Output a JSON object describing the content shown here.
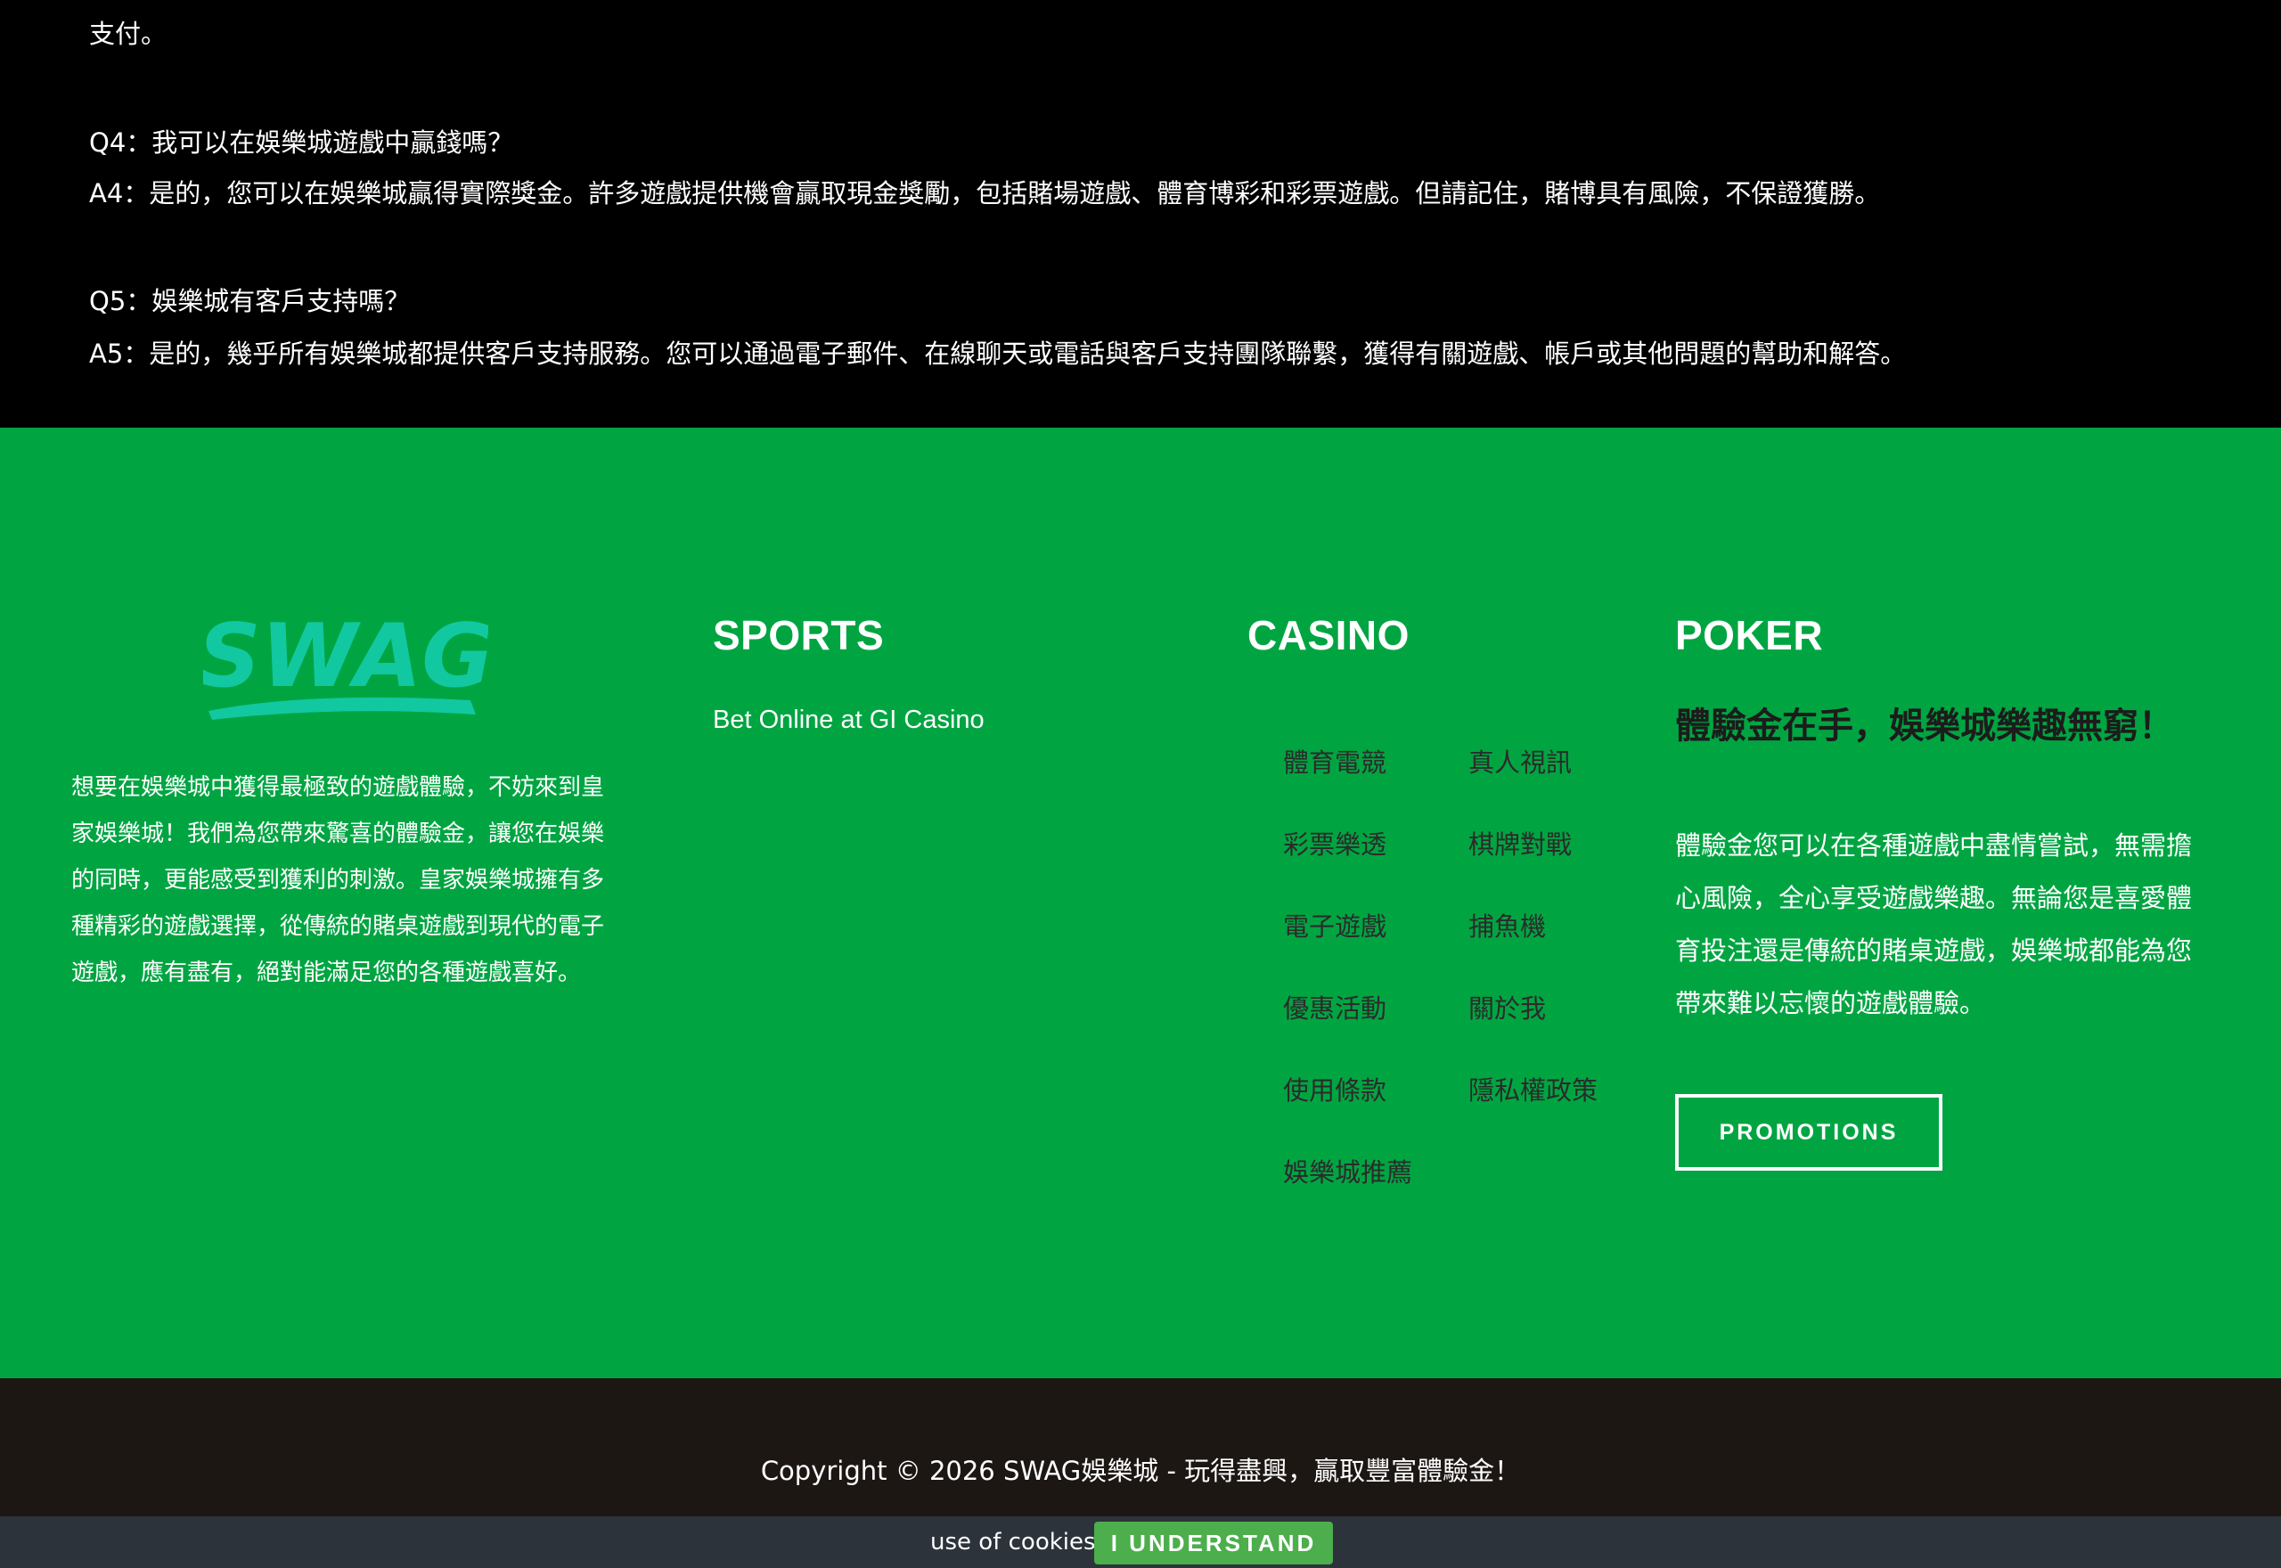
{
  "faq": {
    "lines": [
      "支付。",
      "Q4：我可以在娛樂城遊戲中贏錢嗎？",
      "A4：是的，您可以在娛樂城贏得實際獎金。許多遊戲提供機會贏取現金獎勵，包括賭場遊戲、體育博彩和彩票遊戲。但請記住，賭博具有風險，不保證獲勝。",
      "Q5：娛樂城有客戶支持嗎？",
      "A5：是的，幾乎所有娛樂城都提供客戶支持服務。您可以通過電子郵件、在線聊天或電話與客戶支持團隊聯繫，獲得有關遊戲、帳戶或其他問題的幫助和解答。"
    ]
  },
  "footer": {
    "logo_text": "SWAG",
    "about": "想要在娛樂城中獲得最極致的遊戲體驗，不妨來到皇家娛樂城！我們為您帶來驚喜的體驗金，讓您在娛樂的同時，更能感受到獲利的刺激。皇家娛樂城擁有多種精彩的遊戲選擇，從傳統的賭桌遊戲到現代的電子遊戲，應有盡有，絕對能滿足您的各種遊戲喜好。",
    "sports": {
      "title": "SPORTS",
      "link": "Bet Online at GI Casino"
    },
    "casino": {
      "title": "CASINO",
      "links": [
        "體育電競",
        "真人視訊",
        "彩票樂透",
        "棋牌對戰",
        "電子遊戲",
        "捕魚機",
        "優惠活動",
        "關於我",
        "使用條款",
        "隱私權政策",
        "娛樂城推薦"
      ]
    },
    "poker": {
      "title": "POKER",
      "heading": "體驗金在手，娛樂城樂趣無窮！",
      "text": "體驗金您可以在各種遊戲中盡情嘗試，無需擔心風險，全心享受遊戲樂趣。無論您是喜愛體育投注還是傳統的賭桌遊戲，娛樂城都能為您帶來難以忘懷的遊戲體驗。",
      "button": "PROMOTIONS"
    }
  },
  "copyright": "Copyright © 2026 SWAG娛樂城 - 玩得盡興，贏取豐富體驗金！",
  "cookie": {
    "text": "use of cookies",
    "button": "I UNDERSTAND"
  },
  "colors": {
    "footer_green": "#00a542",
    "logo_teal": "#12c8a0",
    "cookie_button": "#4cae4c",
    "copyright_bg": "#1d1714",
    "cookie_bg": "#2c333b"
  }
}
